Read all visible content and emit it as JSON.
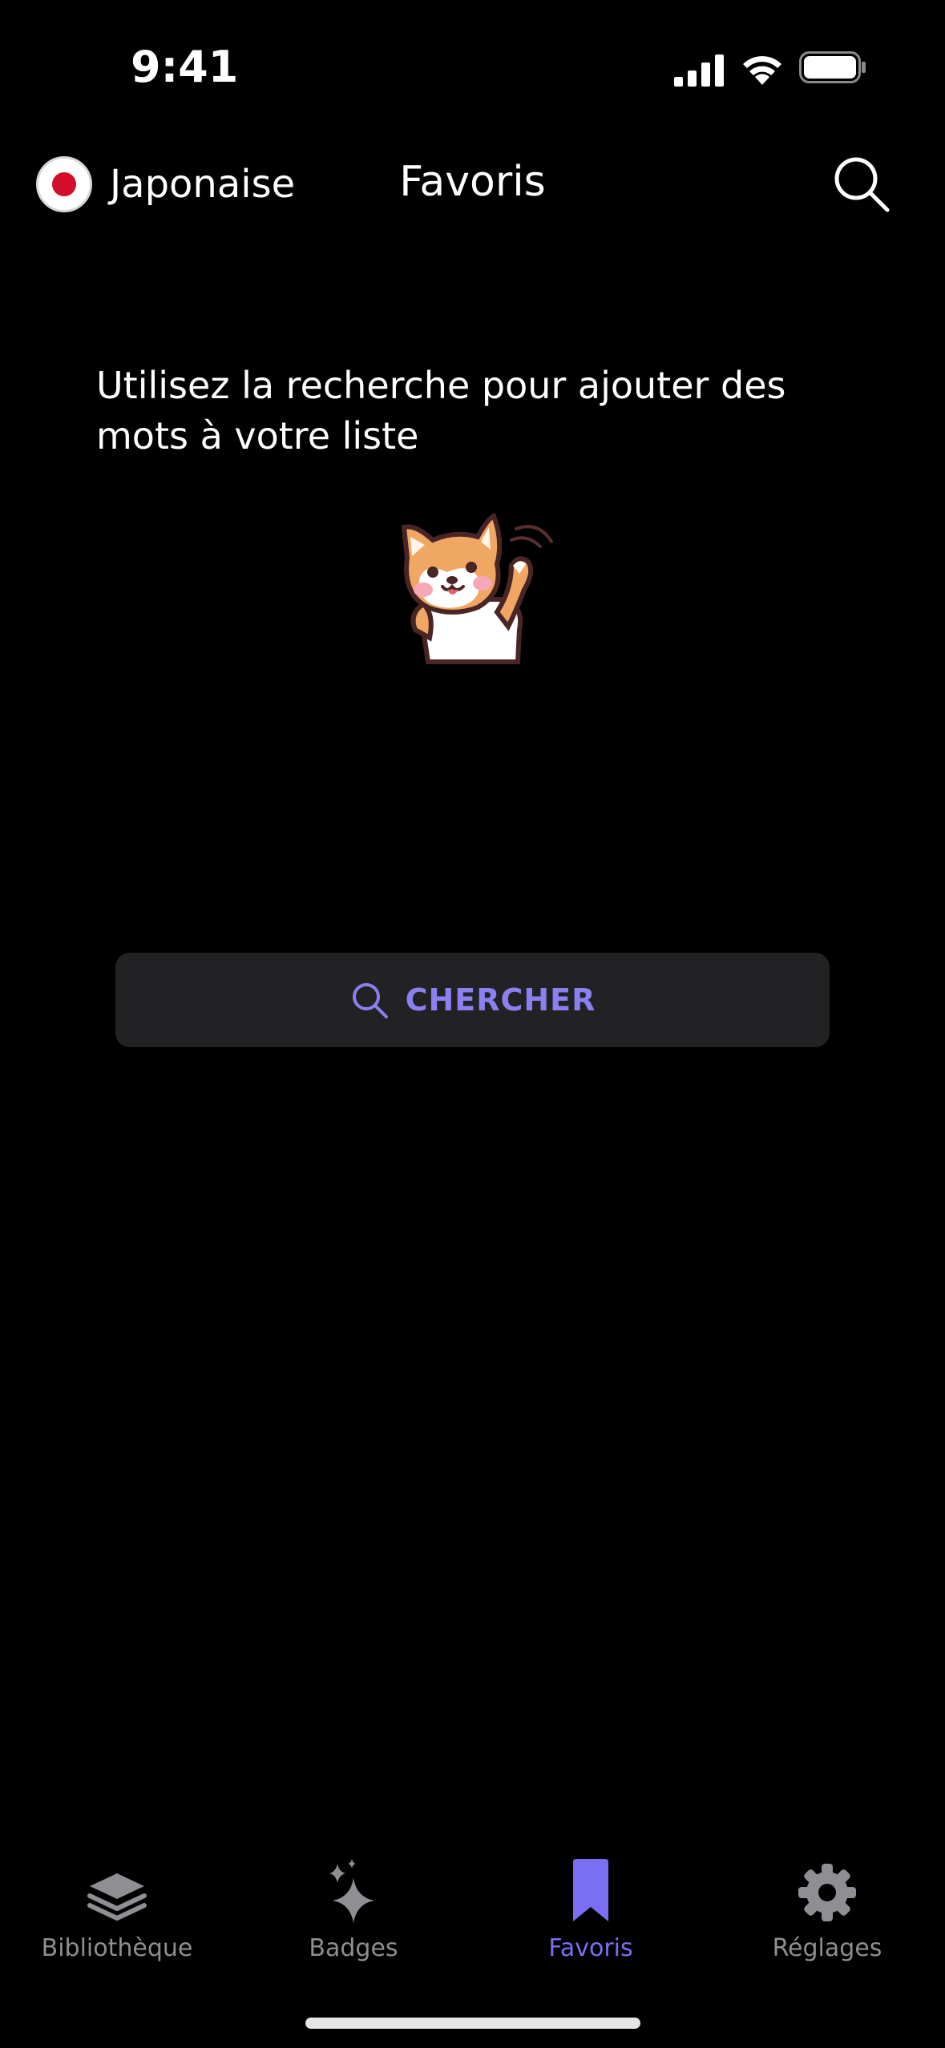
{
  "status_bar": {
    "time": "9:41",
    "icons": [
      "signal-icon",
      "wifi-icon",
      "battery-icon"
    ]
  },
  "header": {
    "language_label": "Japonaise",
    "flag_icon": "japan-flag-icon",
    "title": "Favoris",
    "search_icon": "search-icon"
  },
  "empty_state": {
    "message": "Utilisez la recherche pour ajouter des mots à votre liste",
    "mascot": "shiba-dog-waving"
  },
  "search_button": {
    "label": "CHERCHER",
    "icon": "search-icon"
  },
  "tab_bar": {
    "tabs": [
      {
        "label": "Bibliothèque",
        "icon": "layers-icon",
        "active": false
      },
      {
        "label": "Badges",
        "icon": "sparkles-icon",
        "active": false
      },
      {
        "label": "Favoris",
        "icon": "bookmark-icon",
        "active": true
      },
      {
        "label": "Réglages",
        "icon": "gear-icon",
        "active": false
      }
    ]
  },
  "colors": {
    "background": "#000000",
    "accent": "#7a6ff0",
    "inactive_tab": "#8e8e93",
    "button_background": "#222224",
    "flag_red": "#d10d2b"
  }
}
